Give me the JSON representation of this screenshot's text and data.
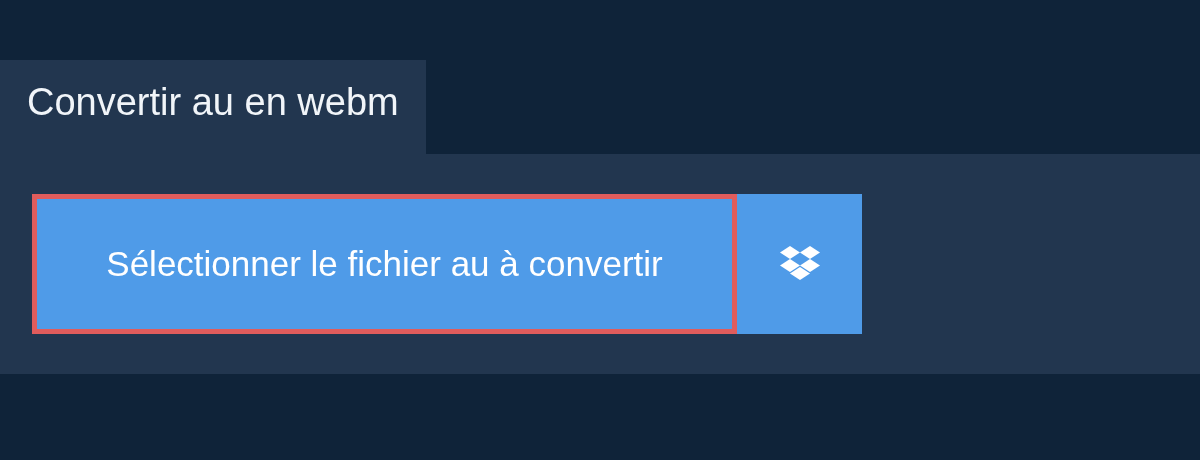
{
  "tab": {
    "label": "Convertir au en webm",
    "selected": true
  },
  "select_button": {
    "label": "Sélectionner le fichier au à convertir",
    "focused": true
  }
}
